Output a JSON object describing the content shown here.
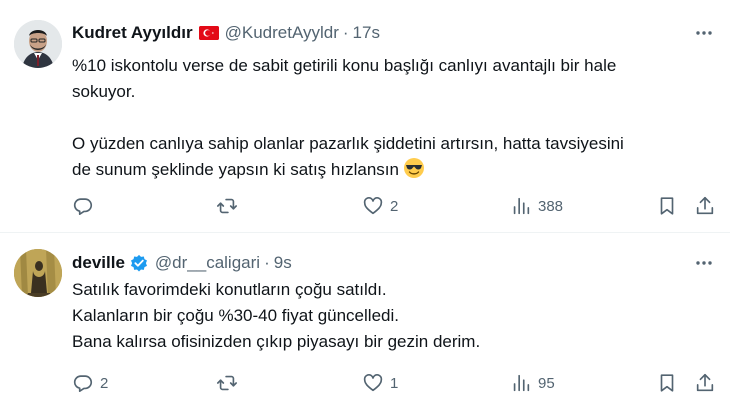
{
  "tweets": [
    {
      "name": "Kudret Ayyıldır",
      "handle": "@KudretAyyldr",
      "separator": "·",
      "time": "17s",
      "text_lines": [
        "%10 iskontolu verse de sabit getirili konu başlığı canlıyı avantajlı bir hale",
        "sokuyor.",
        "",
        "O yüzden canlıya sahip olanlar pazarlık şiddetini artırsın, hatta tavsiyesini",
        "de sunum şeklinde yapsın ki satış hızlansın"
      ],
      "emoji": "smiling-face-with-sunglasses",
      "actions": {
        "replies": "",
        "retweets": "",
        "likes": "2",
        "views": "388"
      }
    },
    {
      "name": "deville",
      "handle": "@dr__caligari",
      "separator": "·",
      "time": "9s",
      "text_lines": [
        "Satılık favorimdeki konutların çoğu satıldı.",
        "Kalanların bir çoğu %30-40 fiyat güncelledi.",
        "Bana kalırsa ofisinizden çıkıp piyasayı bir gezin derim."
      ],
      "actions": {
        "replies": "2",
        "retweets": "",
        "likes": "1",
        "views": "95"
      }
    }
  ],
  "colors": {
    "text": "#0f1419",
    "secondary": "#536471",
    "verified": "#1d9bf0",
    "flag": "#e30a17",
    "divider": "#eff3f4"
  }
}
